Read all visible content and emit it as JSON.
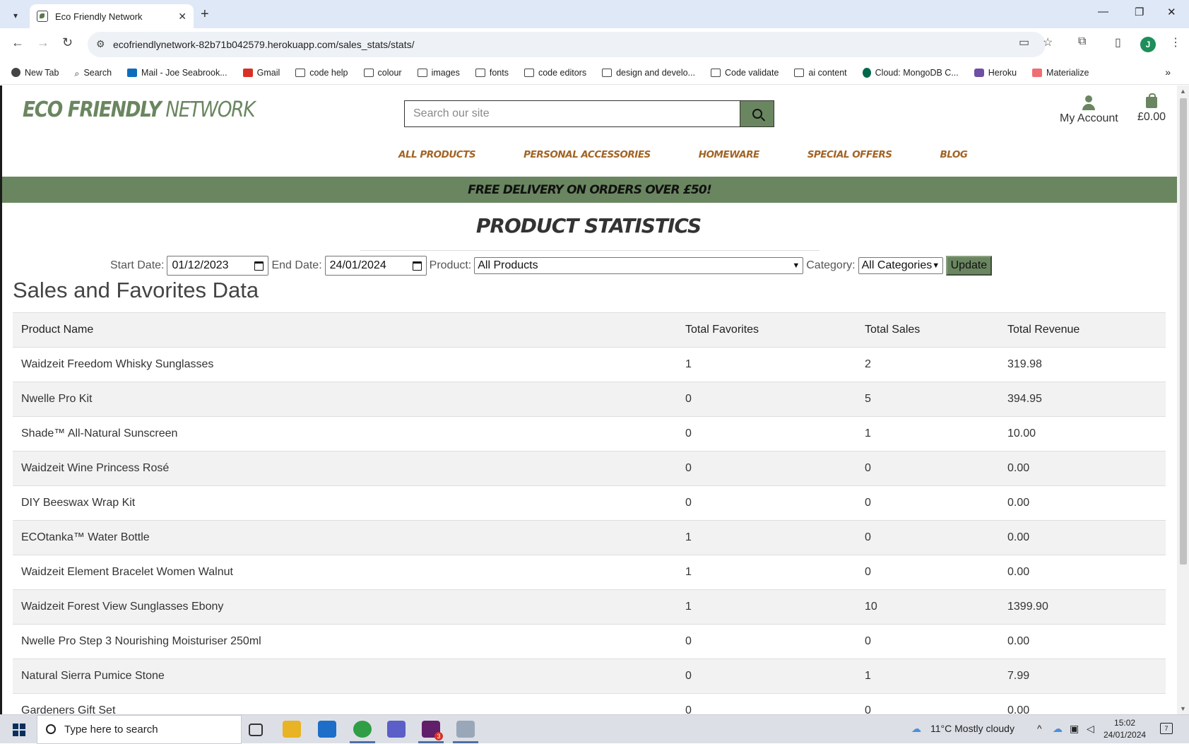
{
  "browser": {
    "tab_title": "Eco Friendly Network",
    "url": "ecofriendlynetwork-82b71b042579.herokuapp.com/sales_stats/stats/",
    "profile_initial": "J",
    "bookmarks": [
      {
        "label": "New Tab",
        "icon": "round-ico"
      },
      {
        "label": "Search",
        "icon": "search-ico"
      },
      {
        "label": "Mail - Joe Seabrook...",
        "icon": "mail-ico"
      },
      {
        "label": "Gmail",
        "icon": "gmail-ico"
      },
      {
        "label": "code help",
        "icon": "folder-ico"
      },
      {
        "label": "colour",
        "icon": "folder-ico"
      },
      {
        "label": "images",
        "icon": "folder-ico"
      },
      {
        "label": "fonts",
        "icon": "folder-ico"
      },
      {
        "label": "code editors",
        "icon": "folder-ico"
      },
      {
        "label": "design and develo...",
        "icon": "folder-ico"
      },
      {
        "label": "Code validate",
        "icon": "folder-ico"
      },
      {
        "label": "ai content",
        "icon": "folder-ico"
      },
      {
        "label": "Cloud: MongoDB C...",
        "icon": "mongo-ico"
      },
      {
        "label": "Heroku",
        "icon": "heroku-ico"
      },
      {
        "label": "Materialize",
        "icon": "mat-ico"
      }
    ]
  },
  "site": {
    "logo_bold": "ECO FRIENDLY",
    "logo_light": " NETWORK",
    "search_placeholder": "Search our site",
    "account_label": "My Account",
    "basket_total": "£0.00",
    "nav": [
      "ALL PRODUCTS",
      "PERSONAL ACCESSORIES",
      "HOMEWARE",
      "SPECIAL OFFERS",
      "BLOG"
    ],
    "banner": "FREE DELIVERY ON ORDERS OVER £50!"
  },
  "page": {
    "title": "PRODUCT STATISTICS",
    "filters": {
      "start_label": "Start Date:",
      "start_value": "01/12/2023",
      "end_label": "End Date:",
      "end_value": "24/01/2024",
      "product_label": "Product:",
      "product_value": "All Products",
      "category_label": "Category:",
      "category_value": "All Categories",
      "update_label": "Update"
    },
    "section_heading": "Sales and Favorites Data",
    "table": {
      "headers": [
        "Product Name",
        "Total Favorites",
        "Total Sales",
        "Total Revenue"
      ],
      "rows": [
        [
          "Waidzeit Freedom Whisky Sunglasses",
          "1",
          "2",
          "319.98"
        ],
        [
          "Nwelle Pro Kit",
          "0",
          "5",
          "394.95"
        ],
        [
          "Shade™ All-Natural Sunscreen",
          "0",
          "1",
          "10.00"
        ],
        [
          "Waidzeit Wine Princess Rosé",
          "0",
          "0",
          "0.00"
        ],
        [
          "DIY Beeswax Wrap Kit",
          "0",
          "0",
          "0.00"
        ],
        [
          "ECOtanka™ Water Bottle",
          "1",
          "0",
          "0.00"
        ],
        [
          "Waidzeit Element Bracelet Women Walnut",
          "1",
          "0",
          "0.00"
        ],
        [
          "Waidzeit Forest View Sunglasses Ebony",
          "1",
          "10",
          "1399.90"
        ],
        [
          "Nwelle Pro Step 3 Nourishing Moisturiser 250ml",
          "0",
          "0",
          "0.00"
        ],
        [
          "Natural Sierra Pumice Stone",
          "0",
          "1",
          "7.99"
        ],
        [
          "Gardeners Gift Set",
          "0",
          "0",
          "0.00"
        ]
      ]
    }
  },
  "taskbar": {
    "search_placeholder": "Type here to search",
    "weather": "11°C  Mostly cloudy",
    "time": "15:02",
    "date": "24/01/2024",
    "notification_count": "7",
    "slack_badge": "3"
  },
  "colors": {
    "brand_green": "#6a8660",
    "nav_orange": "#a36424"
  }
}
